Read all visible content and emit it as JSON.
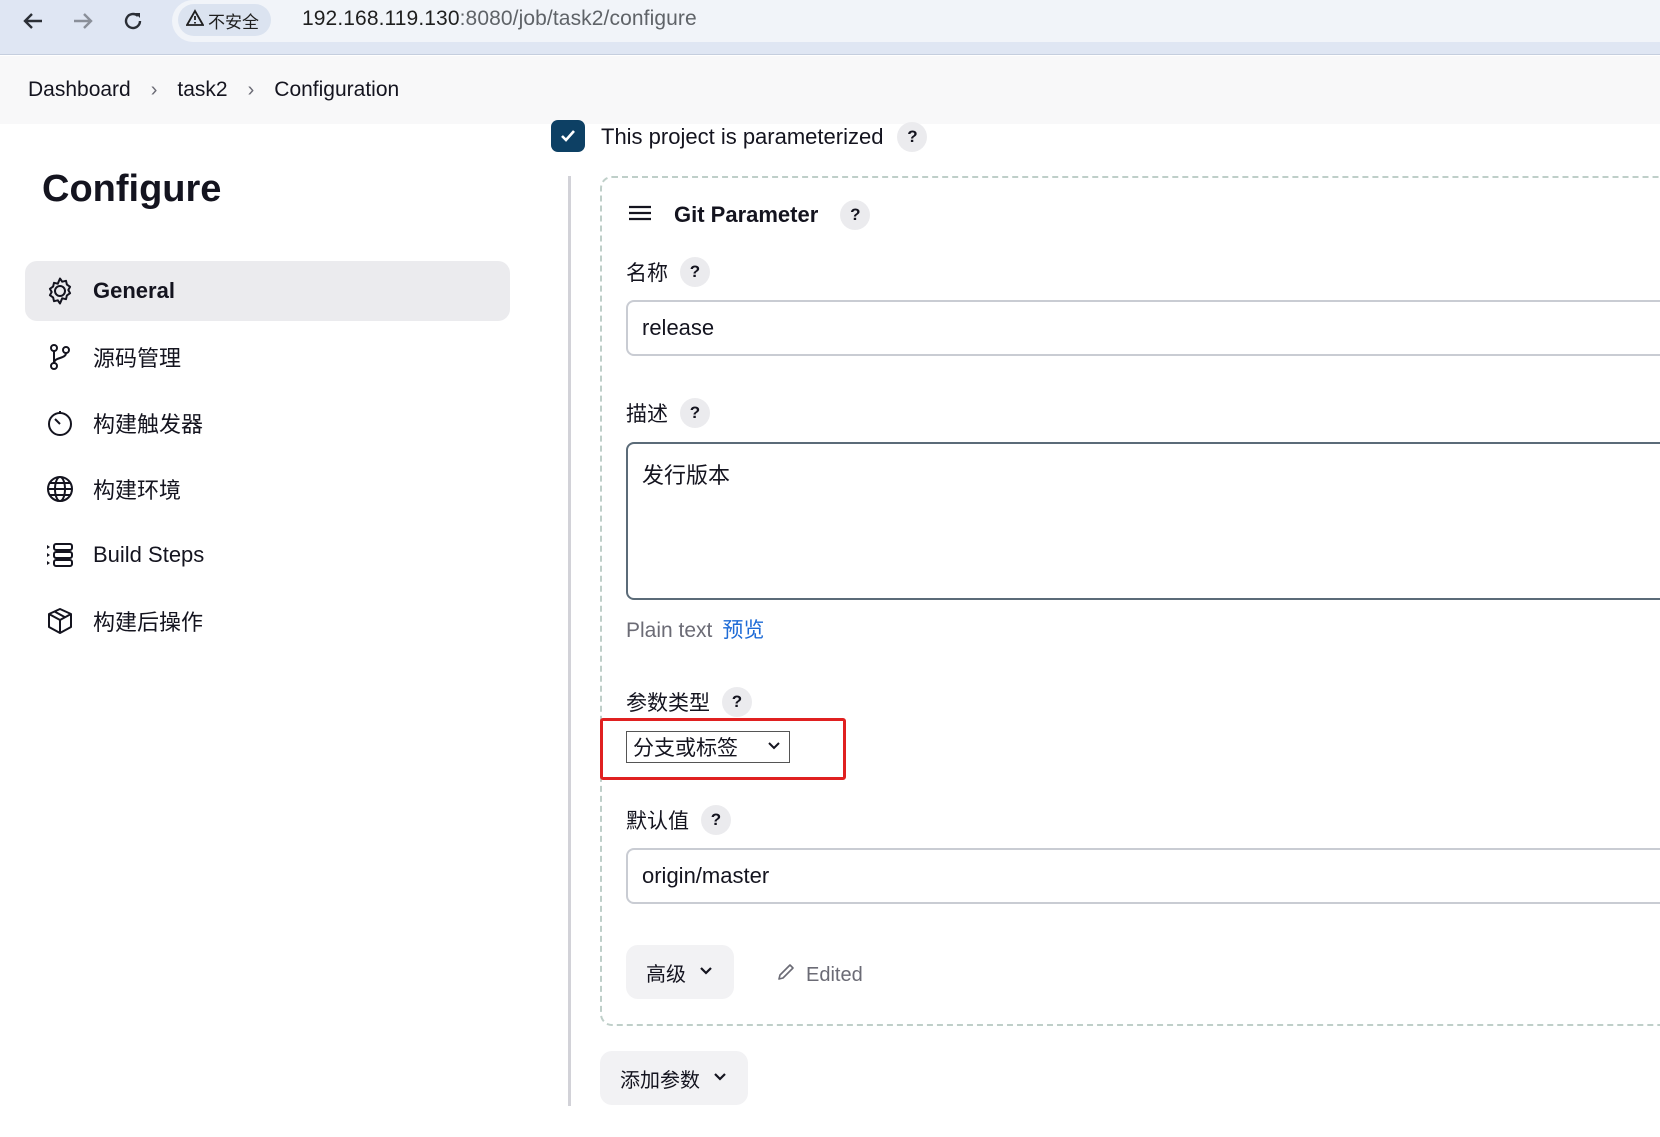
{
  "browser": {
    "security_label": "不安全",
    "url_host": "192.168.119.130",
    "url_rest": ":8080/job/task2/configure"
  },
  "breadcrumb": [
    "Dashboard",
    "task2",
    "Configuration"
  ],
  "sidebar": {
    "title": "Configure",
    "items": [
      {
        "label": "General",
        "icon": "gear-icon",
        "active": true
      },
      {
        "label": "源码管理",
        "icon": "git-branch-icon"
      },
      {
        "label": "构建触发器",
        "icon": "timer-icon"
      },
      {
        "label": "构建环境",
        "icon": "globe-icon"
      },
      {
        "label": "Build Steps",
        "icon": "list-icon"
      },
      {
        "label": "构建后操作",
        "icon": "package-icon"
      }
    ]
  },
  "parameterized": {
    "label": "This project is parameterized",
    "checked": true
  },
  "git_parameter": {
    "title": "Git Parameter",
    "name_label": "名称",
    "name_value": "release",
    "desc_label": "描述",
    "desc_value": "发行版本",
    "format_plain": "Plain text",
    "format_preview": "预览",
    "type_label": "参数类型",
    "type_value": "分支或标签",
    "default_label": "默认值",
    "default_value": "origin/master",
    "advanced_label": "高级",
    "edited_label": "Edited"
  },
  "add_param_label": "添加参数",
  "help_glyph": "?"
}
